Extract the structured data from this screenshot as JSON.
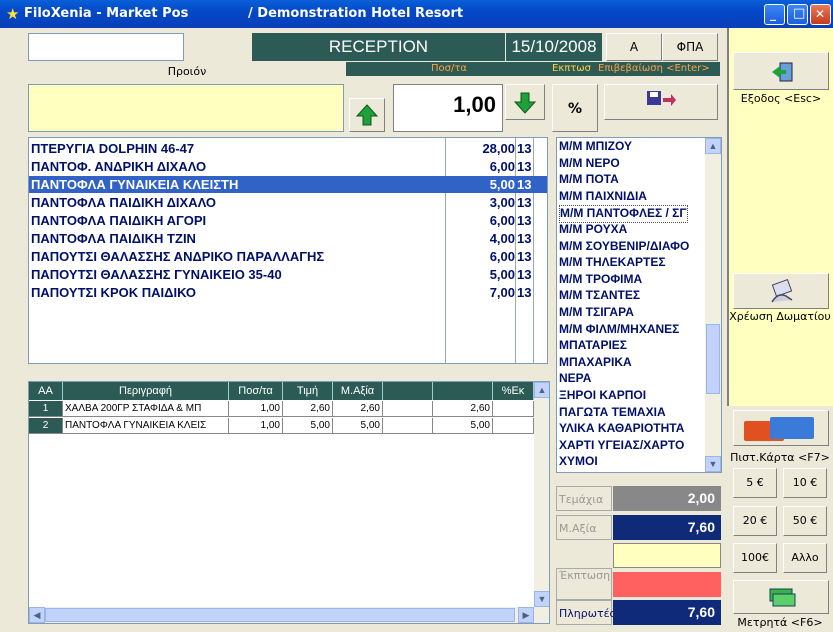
{
  "window": {
    "title": "FiloXenia - Market Pos",
    "subtitle": "/ Demonstration Hotel Resort",
    "controls": {
      "minimize": "_",
      "maximize": "□",
      "close": "✕"
    }
  },
  "header": {
    "mode": "RECEPTION",
    "date": "15/10/2008",
    "btn_a": "A",
    "btn_vat": "ΦΠΑ",
    "product_label": "Προιόν",
    "qty_label": "Ποσ/τα",
    "discount_label": "Εκπτωσ",
    "confirm_label": "Επιβεβαίωση <Enter>",
    "qty_value": "1,00",
    "percent_btn": "%"
  },
  "products": [
    {
      "name": "ΠΤΕΡΥΓΙΑ DOLPHIN 46-47",
      "price": "28,00",
      "vat": "13"
    },
    {
      "name": "ΠΑΝΤΟΦ. ΑΝΔΡΙΚΗ ΔΙΧΑΛΟ",
      "price": "6,00",
      "vat": "13"
    },
    {
      "name": "ΠΑΝΤΟΦΛΑ ΓΥΝΑΙΚΕΙΑ ΚΛΕΙΣΤΗ",
      "price": "5,00",
      "vat": "13",
      "selected": true
    },
    {
      "name": "ΠΑΝΤΟΦΛΑ ΠΑΙΔΙΚΗ ΔΙΧΑΛΟ",
      "price": "3,00",
      "vat": "13"
    },
    {
      "name": "ΠΑΝΤΟΦΛΑ ΠΑΙΔΙΚΗ ΑΓΟΡΙ",
      "price": "6,00",
      "vat": "13"
    },
    {
      "name": "ΠΑΝΤΟΦΛΑ ΠΑΙΔΙΚΗ ΤΖΙΝ",
      "price": "4,00",
      "vat": "13"
    },
    {
      "name": "ΠΑΠΟΥΤΣΙ ΘΑΛΑΣΣΗΣ ΑΝΔΡΙΚΟ ΠΑΡΑΛΛΑΓΗΣ",
      "price": "6,00",
      "vat": "13"
    },
    {
      "name": "ΠΑΠΟΥΤΣΙ ΘΑΛΑΣΣΗΣ ΓΥΝΑΙΚΕΙΟ 35-40",
      "price": "5,00",
      "vat": "13"
    },
    {
      "name": "ΠΑΠΟΥΤΣΙ ΚΡΟΚ ΠΑΙΔΙΚΟ",
      "price": "7,00",
      "vat": "13"
    }
  ],
  "categories": [
    "Μ/Μ ΜΠΙΖΟΥ",
    "Μ/Μ ΝΕΡΟ",
    "Μ/Μ ΠΟΤΑ",
    "Μ/Μ ΠΑΙΧΝΙΔΙΑ",
    "Μ/Μ ΠΑΝΤΟΦΛΕΣ / ΣΓ",
    "Μ/Μ ΡΟΥΧΑ",
    "Μ/Μ ΣΟΥΒΕΝΙΡ/ΔΙΑΦΟ",
    "Μ/Μ ΤΗΛΕΚΑΡΤΕΣ",
    "Μ/Μ ΤΡΟΦΙΜΑ",
    "Μ/Μ ΤΣΑΝΤΕΣ",
    "Μ/Μ ΤΣΙΓΑΡΑ",
    "Μ/Μ ΦΙΛΜ/ΜΗΧΑΝΕΣ",
    "ΜΠΑΤΑΡΙΕΣ",
    "ΜΠΑΧΑΡΙΚΑ",
    "ΝΕΡΑ",
    "ΞΗΡΟΙ ΚΑΡΠΟΙ",
    "ΠΑΓΩΤΑ ΤΕΜΑΧΙΑ",
    "ΥΛΙΚΑ ΚΑΘΑΡΙΟΤΗΤΑ",
    "ΧΑΡΤΙ ΥΓΕΙΑΣ/ΧΑΡΤΟ",
    "ΧΥΜΟΙ"
  ],
  "selected_category_index": 4,
  "grid": {
    "headers": [
      "ΑΑ",
      "Περιγραφή",
      "Ποσ/τα",
      "Τιμή",
      "Μ.Αξία",
      "",
      "",
      "%Εκ"
    ],
    "rows": [
      [
        "1",
        "ΧΑΛΒΑ 200ΓΡ ΣΤΑΦΙΔΑ & ΜΠ",
        "1,00",
        "2,60",
        "2,60",
        "",
        "2,60",
        ""
      ],
      [
        "2",
        "ΠΑΝΤΟΦΛΑ ΓΥΝΑΙΚΕΙΑ ΚΛΕΙΣ",
        "1,00",
        "5,00",
        "5,00",
        "",
        "5,00",
        ""
      ]
    ]
  },
  "totals": {
    "pieces_label": "Τεμάχια",
    "pieces_value": "2,00",
    "net_label": "Μ.Αξία",
    "net_value": "7,60",
    "blank_value": "",
    "discount_label": "Έκπτωση",
    "discount_value": "",
    "payable_label": "Πληρωτέο",
    "payable_value": "7,60"
  },
  "right": {
    "exit_label": "Εξοδος <Esc>",
    "room_charge_label": "Χρέωση Δωματίου",
    "card_label": "Πιστ.Κάρτα <F7>",
    "cash_buttons": [
      "5 €",
      "10 €",
      "20 €",
      "50 €",
      "100€",
      "Αλλο"
    ],
    "cash_label": "Μετρητά <F6>"
  },
  "colors": {
    "teal": "#2c5b55",
    "yellow": "#ffffc0",
    "selection": "#3163c6",
    "navy": "#00106a",
    "discount_red": "#ff6060"
  }
}
